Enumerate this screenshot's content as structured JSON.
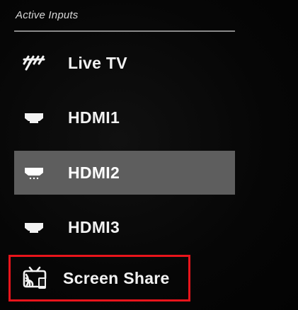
{
  "panel": {
    "title": "Active Inputs"
  },
  "inputs": [
    {
      "label": "Live TV",
      "icon": "antenna-icon",
      "selected": false
    },
    {
      "label": "HDMI1",
      "icon": "hdmi-icon",
      "selected": false
    },
    {
      "label": "HDMI2",
      "icon": "hdmi-icon",
      "selected": true
    },
    {
      "label": "HDMI3",
      "icon": "hdmi-icon",
      "selected": false
    },
    {
      "label": "Screen Share",
      "icon": "screen-share-icon",
      "selected": false
    }
  ],
  "colors": {
    "background": "#050505",
    "selected_row": "#5e5e5e",
    "highlight_border": "#e8141b",
    "text": "#f2f2f2"
  }
}
